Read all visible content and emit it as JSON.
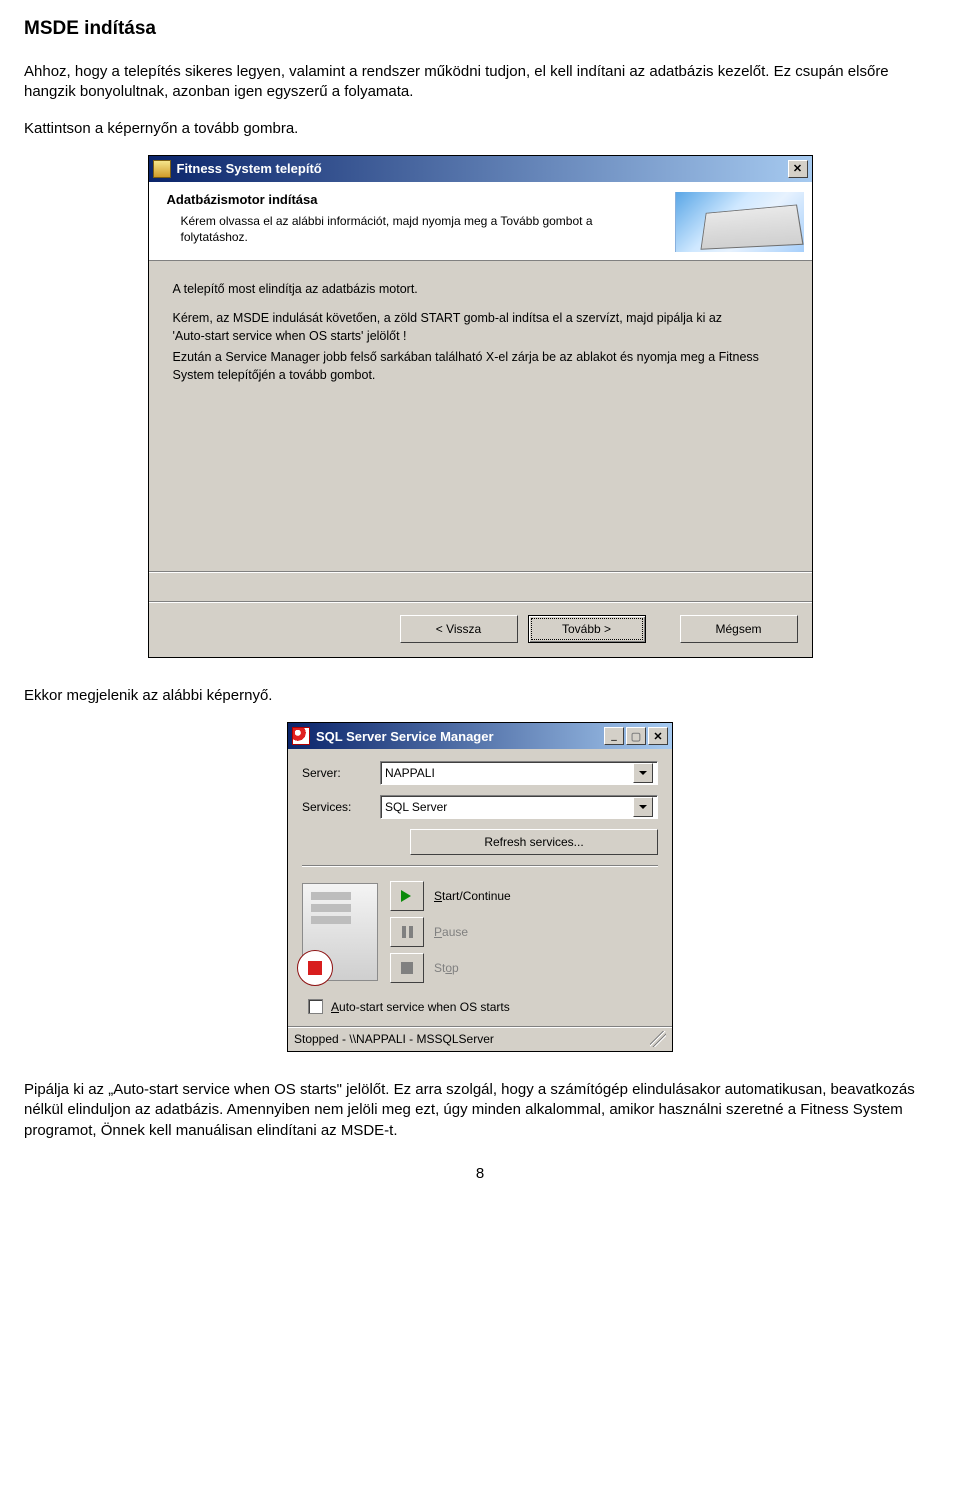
{
  "doc": {
    "heading": "MSDE indítása",
    "p1": "Ahhoz, hogy a telepítés sikeres legyen, valamint a rendszer működni tudjon, el kell indítani az adatbázis kezelőt. Ez csupán elsőre hangzik bonyolultnak, azonban igen egyszerű a folyamata.",
    "p2": "Kattintson a képernyőn a tovább gombra.",
    "mid": "Ekkor megjelenik az alábbi képernyő.",
    "p3": "Pipálja ki az „Auto-start service when OS starts\" jelölőt. Ez arra szolgál, hogy a számítógép elindulásakor automatikusan, beavatkozás nélkül elinduljon az adatbázis. Amennyiben nem jelöli meg ezt, úgy minden alkalommal, amikor használni szeretné a Fitness System programot, Önnek kell manuálisan elindítani az MSDE-t.",
    "page": "8"
  },
  "installer": {
    "title": "Fitness System telepítő",
    "banner_title": "Adatbázismotor indítása",
    "banner_sub": "Kérem olvassa el az alábbi információt, majd nyomja meg a Tovább gombot a folytatáshoz.",
    "body_l1": "A telepítő most elindítja az adatbázis motort.",
    "body_l2": "Kérem, az MSDE indulását követően, a zöld START gomb-al indítsa el a szervízt, majd pipálja ki az",
    "body_l3": "'Auto-start service when OS starts' jelölőt !",
    "body_l4": "Ezután a Service Manager jobb felső sarkában található X-el zárja be az ablakot és nyomja meg a Fitness System telepítőjén a tovább gombot.",
    "btn_back": "< Vissza",
    "btn_next": "Tovább >",
    "btn_cancel": "Mégsem"
  },
  "svc": {
    "title": "SQL Server Service Manager",
    "lbl_server": "Server:",
    "val_server": "NAPPALI",
    "lbl_services": "Services:",
    "val_services": "SQL Server",
    "refresh": "Refresh services...",
    "start": "Start/Continue",
    "pause": "Pause",
    "stop": "Stop",
    "autostart": "Auto-start service when OS starts",
    "status": "Stopped - \\\\NAPPALI - MSSQLServer"
  }
}
